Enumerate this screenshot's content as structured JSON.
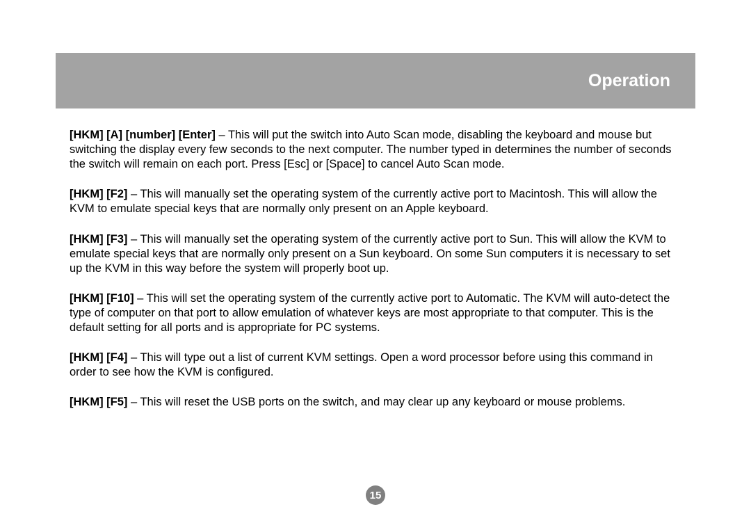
{
  "header": {
    "title": "Operation"
  },
  "paragraphs": [
    {
      "prefix": "[HKM] [A] [number] [Enter]",
      "body": " – This will put the switch into Auto Scan mode, disabling the keyboard and mouse but switching the display every few seconds to the next computer.  The number typed in determines the number of seconds the switch will remain on each port.  Press [Esc] or [Space] to cancel Auto Scan mode."
    },
    {
      "prefix": "[HKM] [F2]",
      "body": " – This will manually set the operating system of the currently active port to Macintosh.  This will allow the KVM to emulate special keys that are normally only present on an Apple keyboard."
    },
    {
      "prefix": "[HKM] [F3]",
      "body": " – This will manually set the operating system of the currently active port to Sun.  This will allow the KVM to emulate special keys that are normally only present on a Sun keyboard.  On some Sun computers it is necessary to set up the KVM in this way before the system will properly boot up."
    },
    {
      "prefix": "[HKM] [F10]",
      "body": " – This will set the operating system of the currently active port to Automatic.  The KVM will auto-detect the type of computer on that port to allow emulation of whatever keys are most appropriate to that computer.  This is the default setting for all ports and is appropriate for PC systems."
    },
    {
      "prefix": "[HKM] [F4]",
      "body": " – This will type out a list of current KVM settings.  Open a word processor before using this command in order to see how the KVM is configured."
    },
    {
      "prefix": "[HKM] [F5]",
      "body": " – This will reset the USB ports on the switch, and may clear up any keyboard or mouse problems."
    }
  ],
  "pageNumber": "15"
}
